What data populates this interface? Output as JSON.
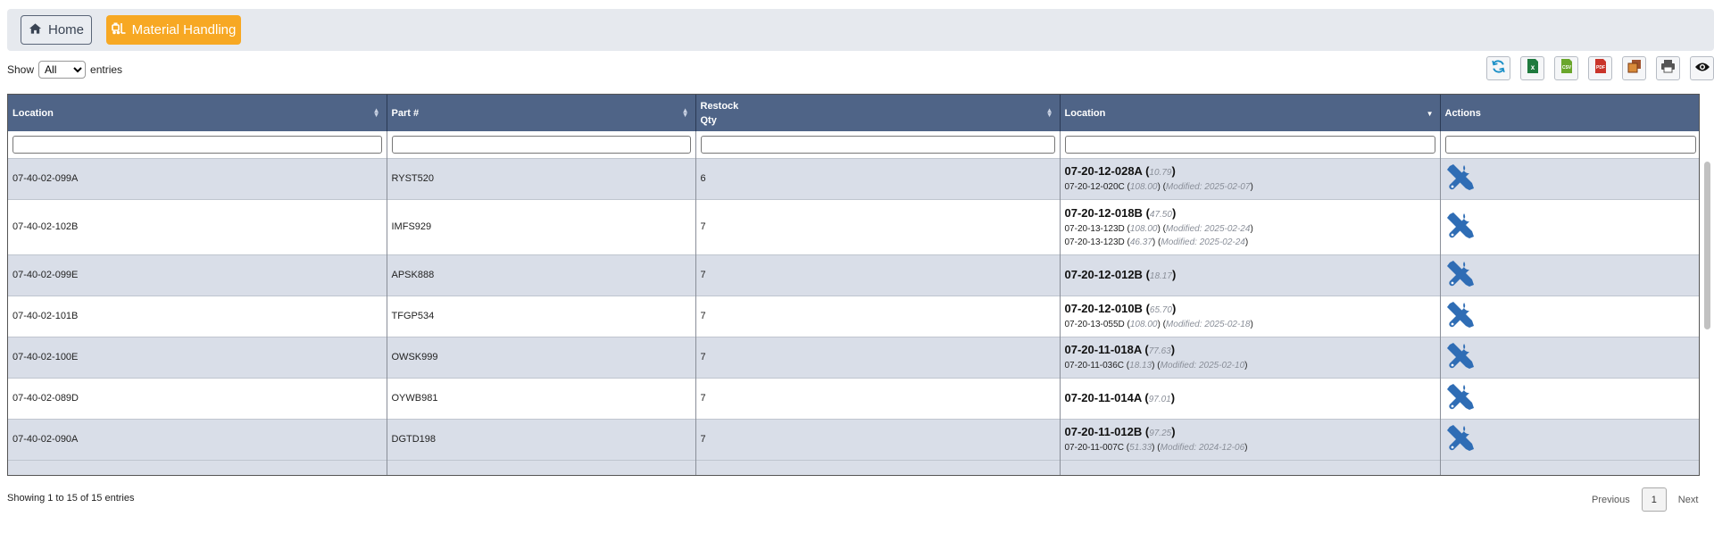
{
  "nav": {
    "home_label": "Home",
    "material_handling_label": "Material Handling"
  },
  "length_control": {
    "show_label": "Show",
    "selected": "All",
    "entries_label": "entries"
  },
  "toolbar": {
    "icons": [
      "refresh-icon",
      "excel-icon",
      "csv-icon",
      "pdf-icon",
      "copy-icon",
      "print-icon",
      "eye-icon"
    ]
  },
  "table": {
    "columns": [
      "Location",
      "Part #",
      "Restock Qty",
      "Location",
      "Actions"
    ],
    "rows": [
      {
        "location": "07-40-02-099A",
        "part": "RYST520",
        "restock_qty": "6",
        "primary_loc": "07-20-12-028A",
        "primary_qty": "10.79",
        "others": [
          {
            "loc": "07-20-12-020C",
            "qty": "108.00",
            "modified": "Modified: 2025-02-07"
          }
        ]
      },
      {
        "location": "07-40-02-102B",
        "part": "IMFS929",
        "restock_qty": "7",
        "primary_loc": "07-20-12-018B",
        "primary_qty": "47.50",
        "others": [
          {
            "loc": "07-20-13-123D",
            "qty": "108.00",
            "modified": "Modified: 2025-02-24"
          },
          {
            "loc": "07-20-13-123D",
            "qty": "46.37",
            "modified": "Modified: 2025-02-24"
          }
        ]
      },
      {
        "location": "07-40-02-099E",
        "part": "APSK888",
        "restock_qty": "7",
        "primary_loc": "07-20-12-012B",
        "primary_qty": "18.17",
        "others": []
      },
      {
        "location": "07-40-02-101B",
        "part": "TFGP534",
        "restock_qty": "7",
        "primary_loc": "07-20-12-010B",
        "primary_qty": "65.70",
        "others": [
          {
            "loc": "07-20-13-055D",
            "qty": "108.00",
            "modified": "Modified: 2025-02-18"
          }
        ]
      },
      {
        "location": "07-40-02-100E",
        "part": "OWSK999",
        "restock_qty": "7",
        "primary_loc": "07-20-11-018A",
        "primary_qty": "77.63",
        "others": [
          {
            "loc": "07-20-11-036C",
            "qty": "18.13",
            "modified": "Modified: 2025-02-10"
          }
        ]
      },
      {
        "location": "07-40-02-089D",
        "part": "OYWB981",
        "restock_qty": "7",
        "primary_loc": "07-20-11-014A",
        "primary_qty": "97.01",
        "others": []
      },
      {
        "location": "07-40-02-090A",
        "part": "DGTD198",
        "restock_qty": "7",
        "primary_loc": "07-20-11-012B",
        "primary_qty": "97.25",
        "others": [
          {
            "loc": "07-20-11-007C",
            "qty": "51.33",
            "modified": "Modified: 2024-12-06"
          }
        ]
      }
    ]
  },
  "footer": {
    "info": "Showing 1 to 15 of 15 entries",
    "previous": "Previous",
    "page": "1",
    "next": "Next"
  }
}
